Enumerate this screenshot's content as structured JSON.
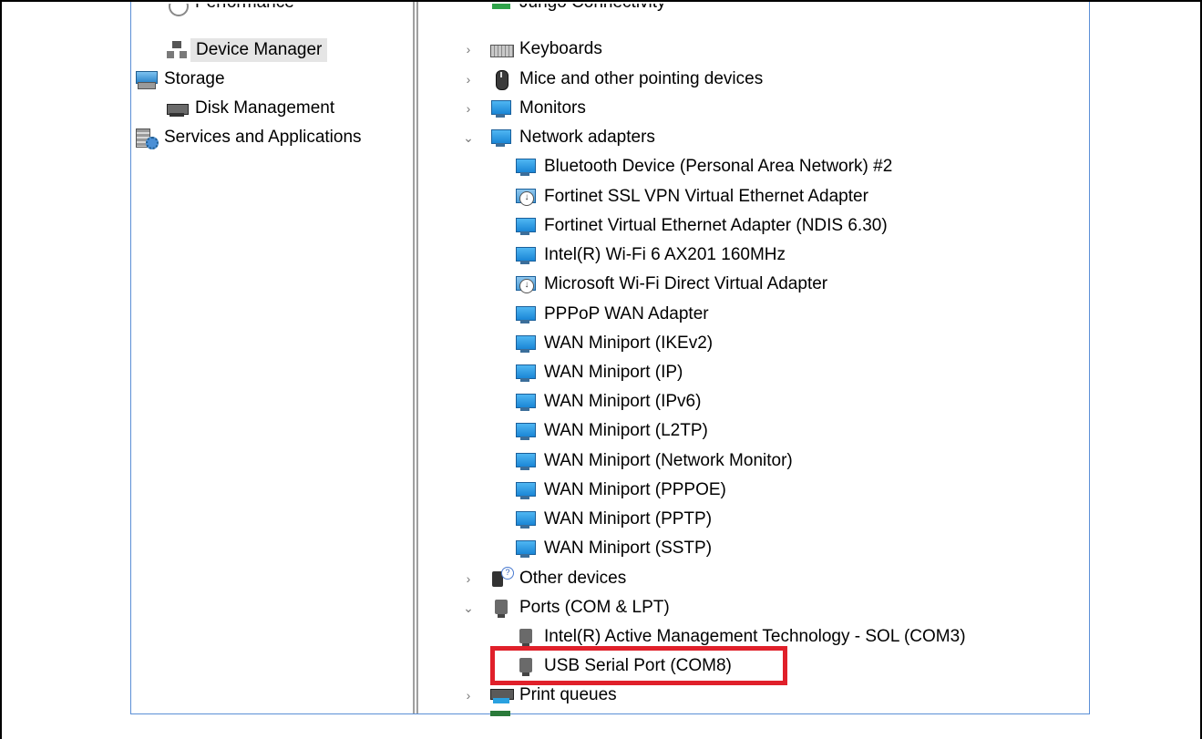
{
  "left_tree": [
    {
      "label": "Performance",
      "icon": "performance-icon"
    },
    {
      "label": "Device Manager",
      "icon": "device-manager-icon",
      "selected": true
    },
    {
      "label": "Storage",
      "icon": "storage-icon"
    },
    {
      "label": "Disk Management",
      "icon": "disk-management-icon"
    },
    {
      "label": "Services and Applications",
      "icon": "services-icon"
    }
  ],
  "device_tree": {
    "cut_top": "Jungo Connectivity",
    "keyboards": "Keyboards",
    "mice": "Mice and other pointing devices",
    "monitors": "Monitors",
    "network_adapters": {
      "label": "Network adapters",
      "children": [
        "Bluetooth Device (Personal Area Network) #2",
        "Fortinet SSL VPN Virtual Ethernet Adapter",
        "Fortinet Virtual Ethernet Adapter (NDIS 6.30)",
        "Intel(R) Wi-Fi 6 AX201 160MHz",
        "Microsoft Wi-Fi Direct Virtual Adapter",
        "PPPoP WAN Adapter",
        "WAN Miniport (IKEv2)",
        "WAN Miniport (IP)",
        "WAN Miniport (IPv6)",
        "WAN Miniport (L2TP)",
        "WAN Miniport (Network Monitor)",
        "WAN Miniport (PPPOE)",
        "WAN Miniport (PPTP)",
        "WAN Miniport (SSTP)"
      ]
    },
    "other_devices": "Other devices",
    "ports": {
      "label": "Ports (COM & LPT)",
      "children": [
        "Intel(R) Active Management Technology - SOL (COM3)",
        "USB Serial Port (COM8)"
      ]
    },
    "print_queues": "Print queues"
  },
  "colors": {
    "highlight": "#e0202a",
    "selection": "#e5e5e5",
    "frame_border": "#5b8fd6"
  }
}
